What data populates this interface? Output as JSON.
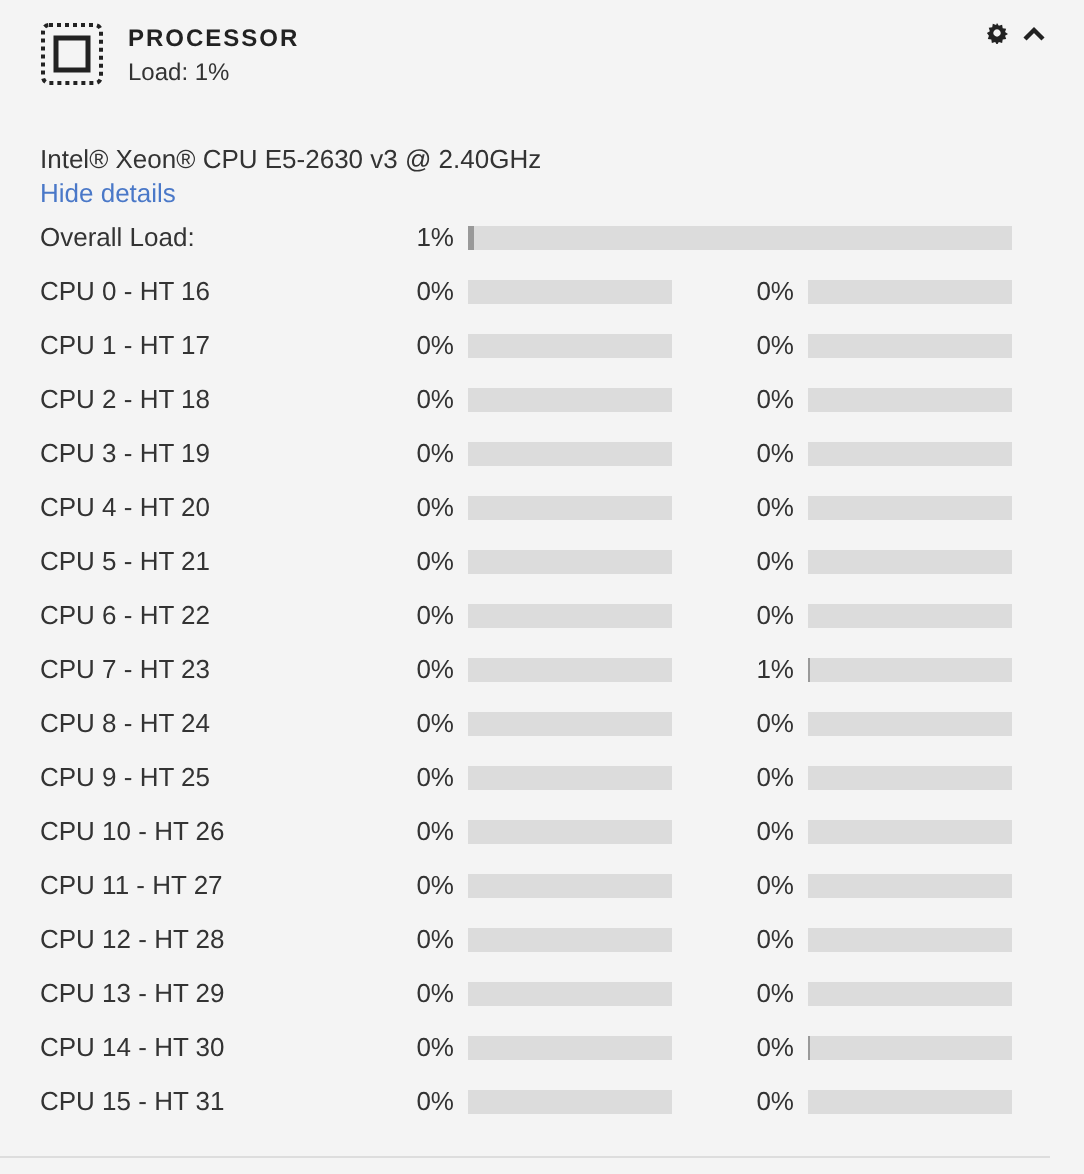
{
  "header": {
    "title": "PROCESSOR",
    "subtitle": "Load: 1%",
    "expanded": true
  },
  "model": "Intel® Xeon® CPU E5-2630 v3 @ 2.40GHz",
  "details_link": "Hide details",
  "overall": {
    "label": "Overall Load:",
    "reading": "1%",
    "level": 0.01
  },
  "cpus": [
    {
      "label": "CPU 0 - HT 16",
      "a": {
        "reading": "0%",
        "level": 0
      },
      "b": {
        "reading": "0%",
        "level": 0
      }
    },
    {
      "label": "CPU 1 - HT 17",
      "a": {
        "reading": "0%",
        "level": 0
      },
      "b": {
        "reading": "0%",
        "level": 0
      }
    },
    {
      "label": "CPU 2 - HT 18",
      "a": {
        "reading": "0%",
        "level": 0
      },
      "b": {
        "reading": "0%",
        "level": 0
      }
    },
    {
      "label": "CPU 3 - HT 19",
      "a": {
        "reading": "0%",
        "level": 0
      },
      "b": {
        "reading": "0%",
        "level": 0
      }
    },
    {
      "label": "CPU 4 - HT 20",
      "a": {
        "reading": "0%",
        "level": 0
      },
      "b": {
        "reading": "0%",
        "level": 0
      }
    },
    {
      "label": "CPU 5 - HT 21",
      "a": {
        "reading": "0%",
        "level": 0
      },
      "b": {
        "reading": "0%",
        "level": 0
      }
    },
    {
      "label": "CPU 6 - HT 22",
      "a": {
        "reading": "0%",
        "level": 0
      },
      "b": {
        "reading": "0%",
        "level": 0
      }
    },
    {
      "label": "CPU 7 - HT 23",
      "a": {
        "reading": "0%",
        "level": 0
      },
      "b": {
        "reading": "1%",
        "level": 0.01
      }
    },
    {
      "label": "CPU 8 - HT 24",
      "a": {
        "reading": "0%",
        "level": 0
      },
      "b": {
        "reading": "0%",
        "level": 0
      }
    },
    {
      "label": "CPU 9 - HT 25",
      "a": {
        "reading": "0%",
        "level": 0
      },
      "b": {
        "reading": "0%",
        "level": 0
      }
    },
    {
      "label": "CPU 10 - HT 26",
      "a": {
        "reading": "0%",
        "level": 0
      },
      "b": {
        "reading": "0%",
        "level": 0
      }
    },
    {
      "label": "CPU 11 - HT 27",
      "a": {
        "reading": "0%",
        "level": 0
      },
      "b": {
        "reading": "0%",
        "level": 0
      }
    },
    {
      "label": "CPU 12 - HT 28",
      "a": {
        "reading": "0%",
        "level": 0
      },
      "b": {
        "reading": "0%",
        "level": 0
      }
    },
    {
      "label": "CPU 13 - HT 29",
      "a": {
        "reading": "0%",
        "level": 0
      },
      "b": {
        "reading": "0%",
        "level": 0
      }
    },
    {
      "label": "CPU 14 - HT 30",
      "a": {
        "reading": "0%",
        "level": 0
      },
      "b": {
        "reading": "0%",
        "level": 0.01
      }
    },
    {
      "label": "CPU 15 - HT 31",
      "a": {
        "reading": "0%",
        "level": 0
      },
      "b": {
        "reading": "0%",
        "level": 0
      }
    }
  ]
}
